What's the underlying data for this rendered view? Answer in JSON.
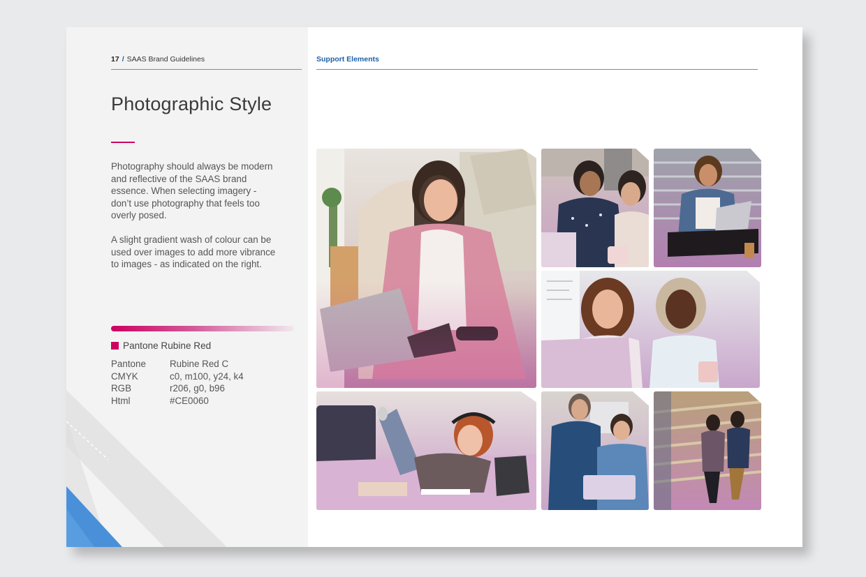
{
  "header": {
    "page_number": "17",
    "separator": "/",
    "doc_title": "SAAS Brand Guidelines",
    "section": "Support Elements"
  },
  "title": "Photographic Style",
  "body": {
    "paragraph1": "Photography should always be modern and reflective of the SAAS brand essence. When selecting imagery - don’t use photography that feels too overly posed.",
    "paragraph2": "A slight gradient wash of colour can be used over images to add more vibrance to images - as indicated on the right."
  },
  "pantone": {
    "name": "Pantone Rubine Red",
    "swatch_color": "#CE0060",
    "specs": [
      {
        "key": "Pantone",
        "value": "Rubine Red C"
      },
      {
        "key": "CMYK",
        "value": "c0, m100, y24, k4"
      },
      {
        "key": "RGB",
        "value": "r206, g0, b96"
      },
      {
        "key": "Html",
        "value": "#CE0060"
      }
    ]
  },
  "colors": {
    "accent_blue": "#1f5fa8",
    "rubine_red": "#CE0060"
  },
  "photos": [
    {
      "name": "woman-laptop-sofa-photo"
    },
    {
      "name": "two-women-desk-photo"
    },
    {
      "name": "woman-stairs-laptop-photo"
    },
    {
      "name": "two-women-laptop-photo"
    },
    {
      "name": "girl-headphones-bed-photo"
    },
    {
      "name": "mentor-student-laptop-photo"
    },
    {
      "name": "students-stairs-photo"
    }
  ]
}
